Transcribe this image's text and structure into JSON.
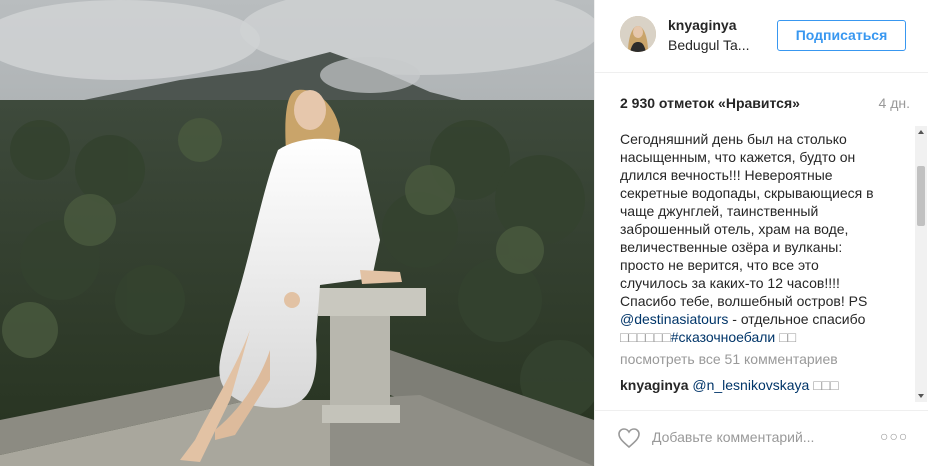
{
  "post": {
    "username": "knyaginya",
    "location": "Bedugul Ta...",
    "follow_label": "Подписаться",
    "likes": "2 930 отметок «Нравится»",
    "time": "4 дн."
  },
  "caption": {
    "lines": [
      "Сегодняшний день был на столько",
      "насыщенным, что кажется, будто он",
      "длился вечность!!! Невероятные",
      "секретные водопады, скрывающиеся в",
      "чаще джунглей, таинственный",
      "заброшенный отель, храм на воде,",
      "величественные озёра и вулканы:",
      "просто не верится, что все это",
      "случилось за каких-то 12 часов!!!!",
      "Спасибо тебе, волшебный остров! PS"
    ],
    "mention": "@destinasiatours",
    "after_mention": " - отдельное спасибо",
    "emoji_boxes": "□□□□□□",
    "hashtag": "#сказочноебали",
    "trailing_boxes": " □□"
  },
  "view_all": "посмотреть все 51 комментариев",
  "comment": {
    "username": "knyaginya",
    "mention": "@n_lesnikovskaya",
    "trailing_boxes": " □□□"
  },
  "footer": {
    "add_comment_placeholder": "Добавьте комментарий...",
    "more_label": "○○○"
  },
  "colors": {
    "link": "#003569",
    "follow": "#3897f0",
    "muted": "#999999",
    "text": "#262626"
  }
}
